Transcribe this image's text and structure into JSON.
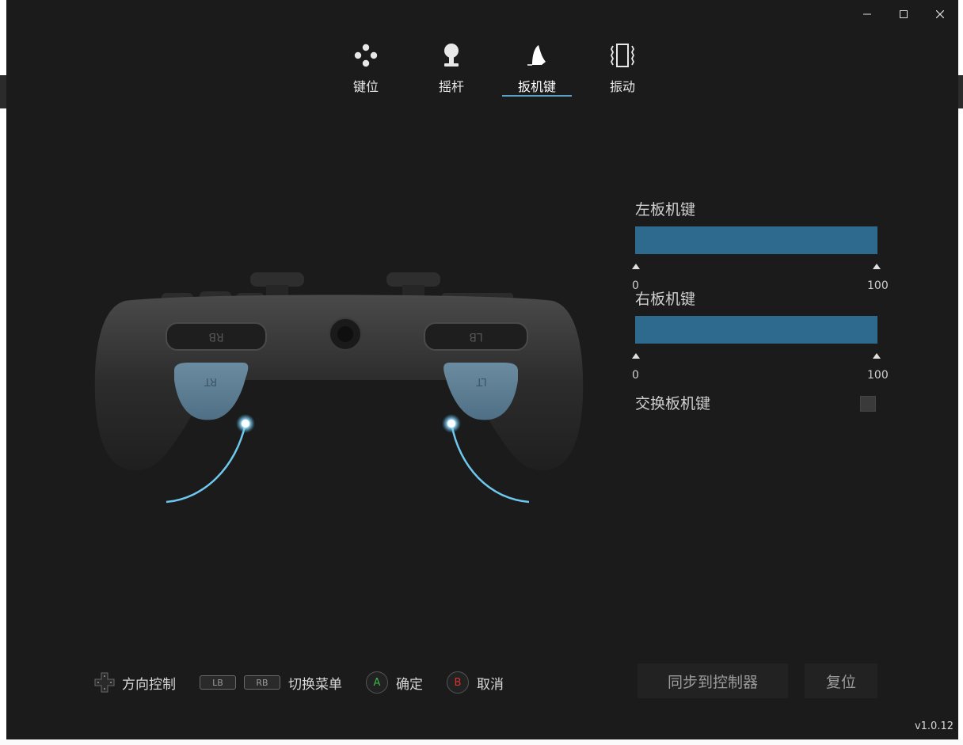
{
  "tabs": [
    {
      "label": "键位",
      "icon": "buttons-icon",
      "active": false
    },
    {
      "label": "摇杆",
      "icon": "joystick-icon",
      "active": false
    },
    {
      "label": "扳机键",
      "icon": "trigger-icon",
      "active": true
    },
    {
      "label": "振动",
      "icon": "vibration-icon",
      "active": false
    }
  ],
  "controller": {
    "labels": {
      "rb": "RB",
      "lb": "LB",
      "rt": "RT",
      "lt": "LT"
    }
  },
  "panel": {
    "left_trigger": {
      "label": "左板机键",
      "min_label": "0",
      "max_label": "100",
      "range_start": 0,
      "range_end": 100
    },
    "right_trigger": {
      "label": "右板机键",
      "min_label": "0",
      "max_label": "100",
      "range_start": 0,
      "range_end": 100
    },
    "swap_label": "交换板机键",
    "swap_checked": false
  },
  "footer": {
    "dpad_label": "方向控制",
    "lb_key": "LB",
    "rb_key": "RB",
    "switch_label": "切换菜单",
    "a_key": "A",
    "confirm_label": "确定",
    "b_key": "B",
    "cancel_label": "取消"
  },
  "actions": {
    "sync_label": "同步到控制器",
    "reset_label": "复位"
  },
  "version": "v1.0.12",
  "colors": {
    "accent": "#5aa0c8",
    "bar": "#2a6486",
    "trigger_blue": "#5c7f96",
    "a_green": "#3bb54a",
    "b_red": "#d9342b"
  }
}
